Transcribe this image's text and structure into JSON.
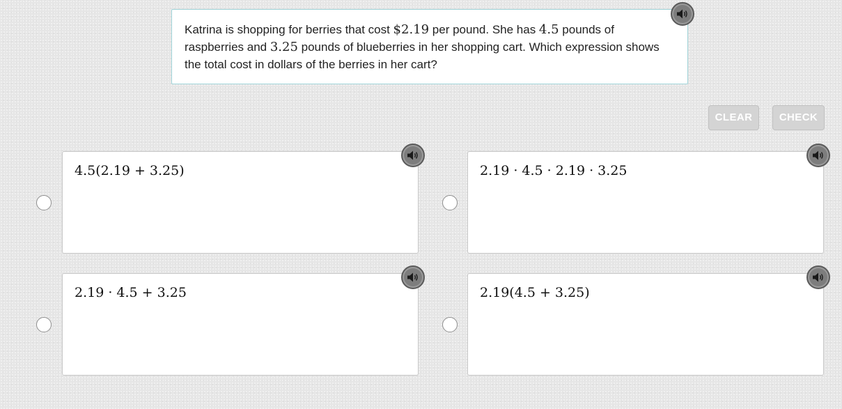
{
  "question": {
    "segments": [
      {
        "text": "Katrina is shopping for berries that cost ",
        "math": false
      },
      {
        "text": "$2.19",
        "math": true
      },
      {
        "text": " per pound. She has ",
        "math": false
      },
      {
        "text": "4.5",
        "math": true
      },
      {
        "text": " pounds of raspberries and ",
        "math": false
      },
      {
        "text": "3.25",
        "math": true
      },
      {
        "text": " pounds of blueberries in her shopping cart. Which expression shows the total cost in dollars of the berries in her cart?",
        "math": false
      }
    ],
    "audio_icon": "speaker-icon"
  },
  "buttons": {
    "clear": "CLEAR",
    "check": "CHECK"
  },
  "choices": [
    {
      "expression": "4.5(2.19 + 3.25)",
      "audio_icon": "speaker-icon"
    },
    {
      "expression": "2.19 · 4.5 · 2.19 · 3.25",
      "audio_icon": "speaker-icon"
    },
    {
      "expression": "2.19 · 4.5 + 3.25",
      "audio_icon": "speaker-icon"
    },
    {
      "expression": "2.19(4.5 + 3.25)",
      "audio_icon": "speaker-icon"
    }
  ],
  "colors": {
    "background": "#e6e6e6",
    "question_border": "#9fd3d8",
    "button_disabled": "#d4d4d4",
    "audio_button": "#7d7d7d"
  }
}
